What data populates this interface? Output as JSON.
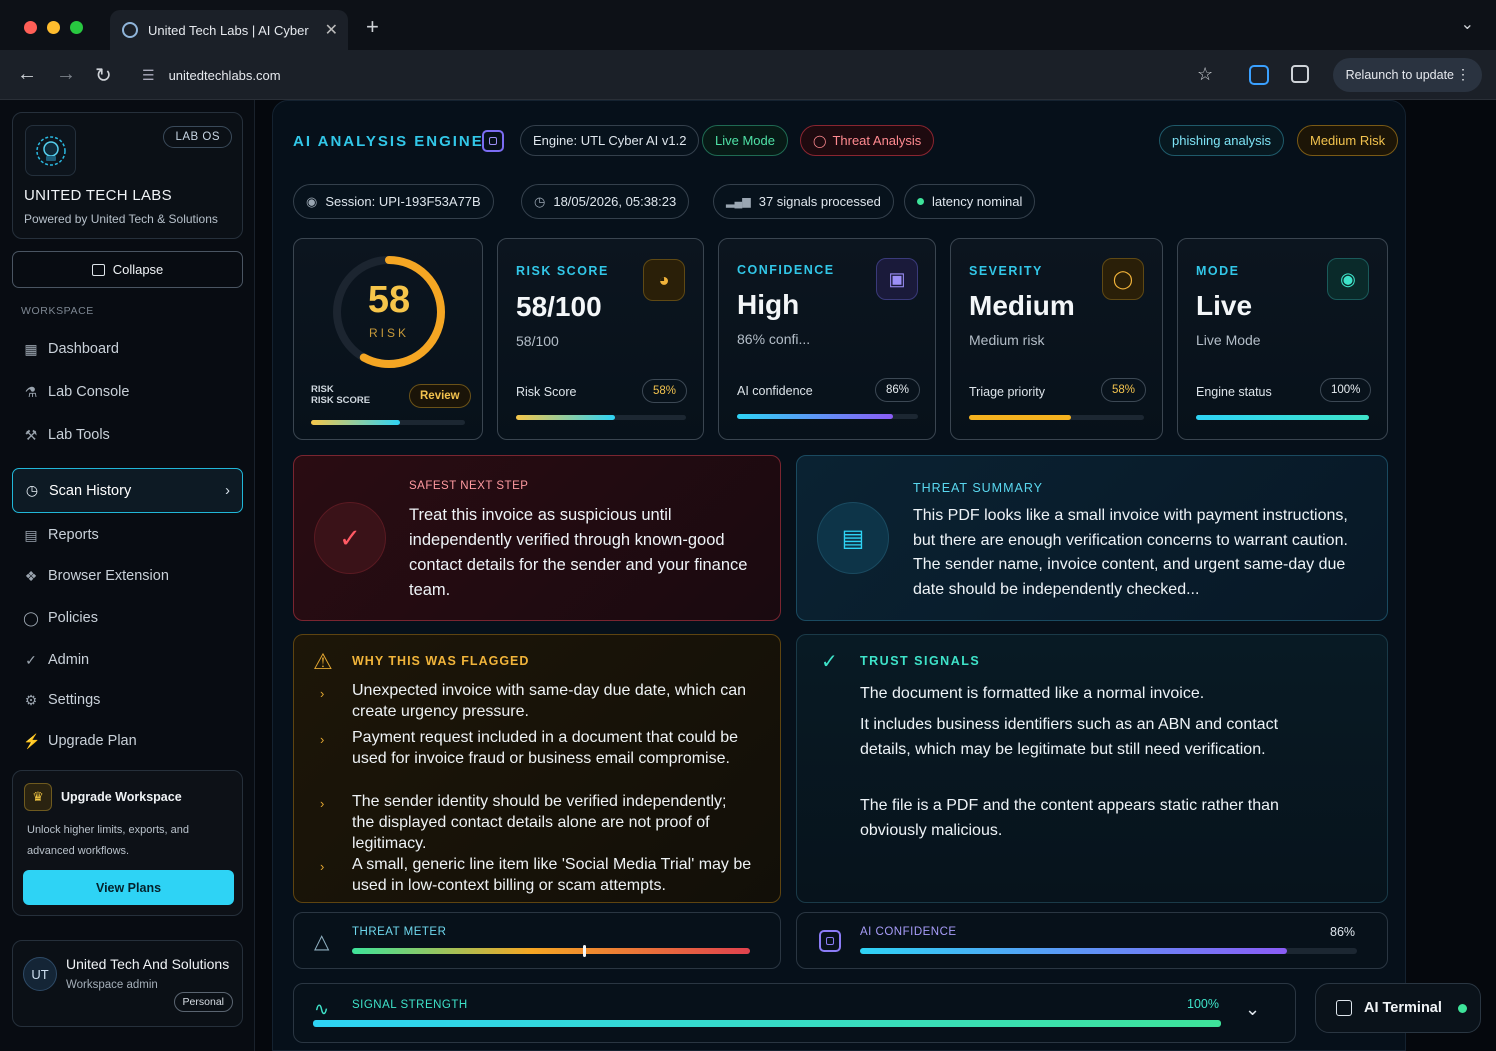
{
  "browser": {
    "tab_title": "United Tech Labs | AI Cyber",
    "tab_close": "✕",
    "new_tab": "+",
    "url": "unitedtechlabs.com",
    "relaunch": "Relaunch to update"
  },
  "sidebar": {
    "badge": "LAB OS",
    "brand": "UNITED TECH LABS",
    "brand_sub": "Powered by United Tech & Solutions",
    "collapse": "Collapse",
    "section": "WORKSPACE",
    "items": [
      {
        "label": "Dashboard",
        "icon": "grid-icon"
      },
      {
        "label": "Lab Console",
        "icon": "flask-icon"
      },
      {
        "label": "Lab Tools",
        "icon": "wrench-icon"
      },
      {
        "label": "Scan History",
        "icon": "history-icon"
      },
      {
        "label": "Reports",
        "icon": "document-icon"
      },
      {
        "label": "Browser Extension",
        "icon": "puzzle-icon"
      },
      {
        "label": "Policies",
        "icon": "shield-icon"
      },
      {
        "label": "Admin",
        "icon": "shield-check-icon"
      },
      {
        "label": "Settings",
        "icon": "gear-icon"
      },
      {
        "label": "Upgrade Plan",
        "icon": "bolt-icon"
      }
    ],
    "upgrade": {
      "title": "Upgrade Workspace",
      "desc": "Unlock higher limits, exports, and advanced workflows.",
      "button": "View Plans"
    },
    "user": {
      "initials": "UT",
      "name": "United Tech And Solutions",
      "role": "Workspace admin",
      "plan": "Personal"
    }
  },
  "header": {
    "title": "AI ANALYSIS ENGINE",
    "engine": "Engine: UTL Cyber AI v1.2",
    "live_mode": "Live Mode",
    "threat_analysis": "Threat Analysis",
    "tag_category": "phishing analysis",
    "tag_risk": "Medium Risk",
    "session": "Session: UPI-193F53A77B",
    "timestamp": "18/05/2026, 05:38:23",
    "signals": "37 signals processed",
    "latency": "latency nominal"
  },
  "gauge": {
    "value": "58",
    "label": "RISK",
    "caption_line1": "RISK",
    "caption_line2": "RISK SCORE",
    "badge": "Review",
    "fraction": 0.58
  },
  "metrics": [
    {
      "label": "RISK SCORE",
      "value": "58/100",
      "sub": "58/100",
      "row": "Risk Score",
      "pct": "58%",
      "fraction": 0.58,
      "icon": "gauge-icon"
    },
    {
      "label": "CONFIDENCE",
      "value": "High",
      "sub": "86% confi...",
      "row": "AI confidence",
      "pct": "86%",
      "fraction": 0.86,
      "icon": "cpu-icon"
    },
    {
      "label": "SEVERITY",
      "value": "Medium",
      "sub": "Medium risk",
      "row": "Triage priority",
      "pct": "58%",
      "fraction": 0.58,
      "icon": "shield-alert-icon"
    },
    {
      "label": "MODE",
      "value": "Live",
      "sub": "Live Mode",
      "row": "Engine status",
      "pct": "100%",
      "fraction": 1.0,
      "icon": "fingerprint-icon"
    }
  ],
  "safest": {
    "label": "SAFEST NEXT STEP",
    "text": "Treat this invoice as suspicious until independently verified through known-good contact details for the sender and your finance team."
  },
  "summary": {
    "label": "THREAT SUMMARY",
    "text": "This PDF looks like a small invoice with payment instructions, but there are enough verification concerns to warrant caution. The sender name, invoice content, and urgent same-day due date should be independently checked..."
  },
  "flagged": {
    "label": "WHY THIS WAS FLAGGED",
    "items": [
      "Unexpected invoice with same-day due date, which can create urgency pressure.",
      "Payment request included in a document that could be used for invoice fraud or business email compromise.",
      "The sender identity should be verified independently; the displayed contact details alone are not proof of legitimacy.",
      "A small, generic line item like 'Social Media Trial' may be used in low-context billing or scam attempts."
    ]
  },
  "trust": {
    "label": "TRUST SIGNALS",
    "items": [
      "The document is formatted like a normal invoice.",
      "It includes business identifiers such as an ABN and contact details, which may be legitimate but still need verification.",
      "The file is a PDF and the content appears static rather than obviously malicious."
    ]
  },
  "meters": {
    "threat_label": "THREAT METER",
    "threat_fraction": 0.58,
    "confidence_label": "AI CONFIDENCE",
    "confidence_value": "86%",
    "confidence_fraction": 0.86,
    "signal_label": "SIGNAL STRENGTH",
    "signal_value": "100%",
    "signal_fraction": 1.0
  },
  "terminal": {
    "label": "AI Terminal"
  },
  "colors": {
    "accent": "#2ed3f5",
    "warning": "#e0a531",
    "danger": "#e0424e"
  }
}
